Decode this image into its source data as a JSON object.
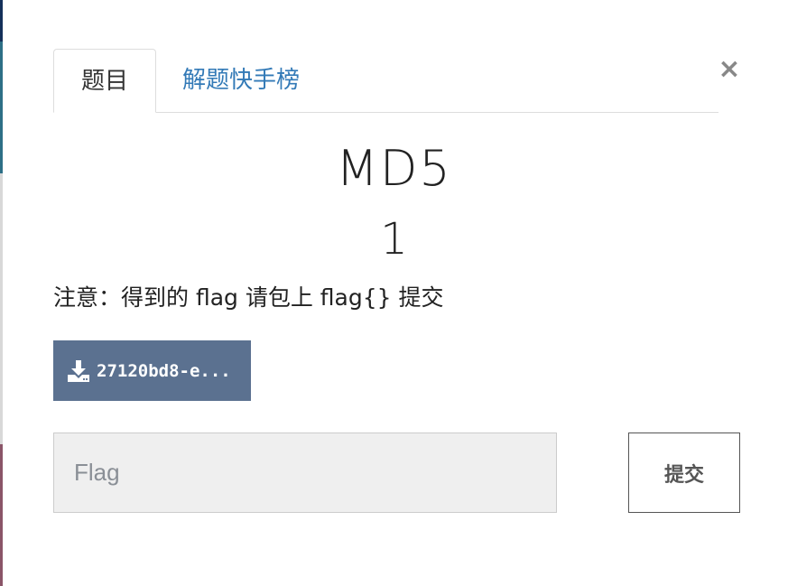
{
  "modal": {
    "tabs": [
      {
        "label": "题目",
        "active": true
      },
      {
        "label": "解题快手榜",
        "active": false
      }
    ],
    "close_label": "×",
    "challenge": {
      "name": "MD5",
      "points": "1",
      "description": "注意：得到的 flag 请包上 flag{} 提交"
    },
    "attachment": {
      "icon": "download-icon",
      "label": "27120bd8-e..."
    },
    "flag_input": {
      "placeholder": "Flag",
      "value": ""
    },
    "submit_label": "提交"
  },
  "colors": {
    "tab_link": "#337ab7",
    "download_bg": "#5b7190",
    "input_bg": "#efefef",
    "text": "#222222"
  }
}
